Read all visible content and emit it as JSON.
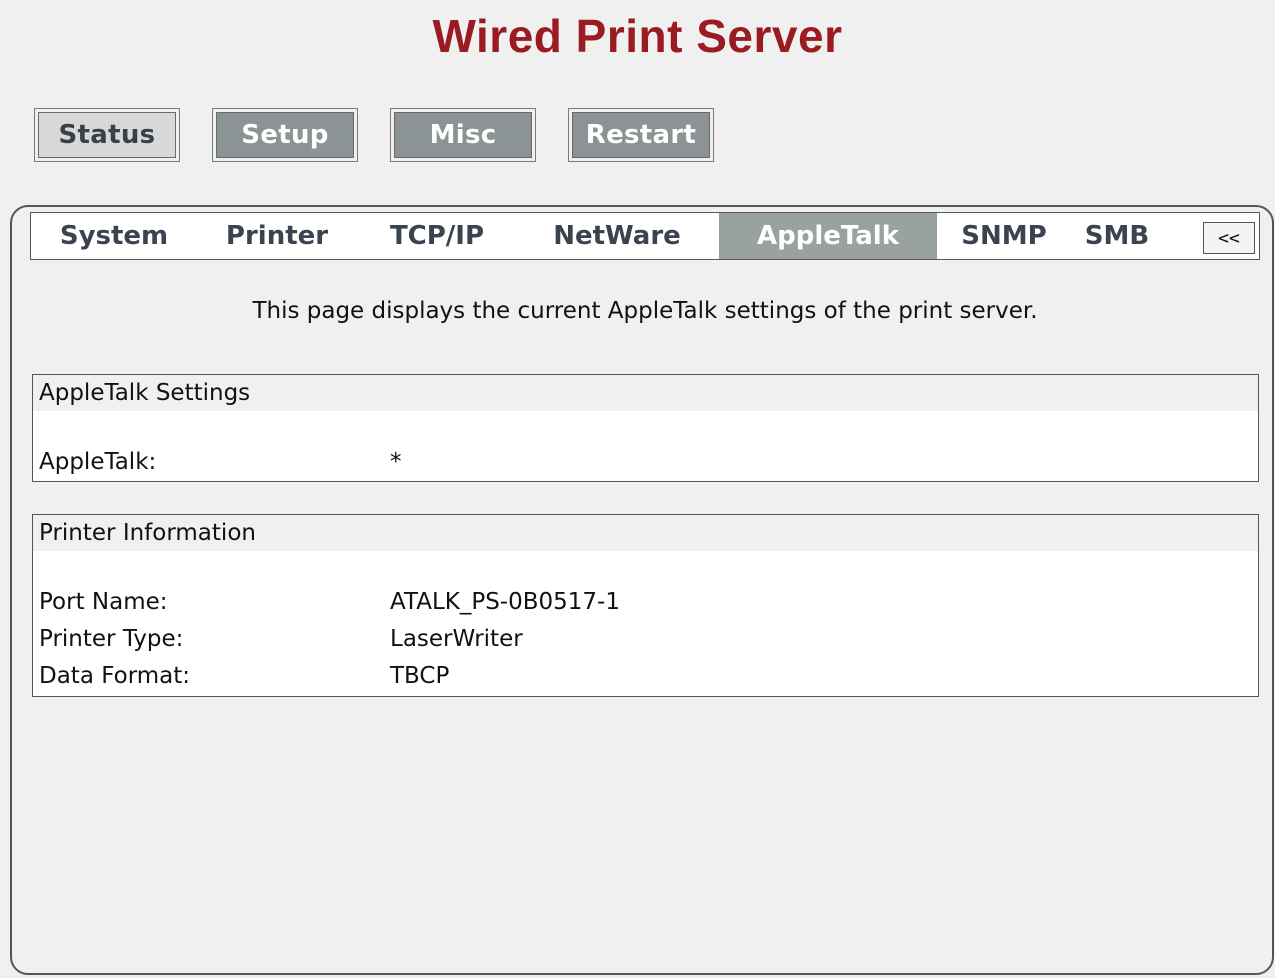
{
  "app": {
    "title": "Wired Print Server"
  },
  "topnav": {
    "items": [
      {
        "label": "Status",
        "active": true
      },
      {
        "label": "Setup",
        "active": false
      },
      {
        "label": "Misc",
        "active": false
      },
      {
        "label": "Restart",
        "active": false
      }
    ]
  },
  "tabs": {
    "items": [
      {
        "label": "System"
      },
      {
        "label": "Printer"
      },
      {
        "label": "TCP/IP"
      },
      {
        "label": "NetWare"
      },
      {
        "label": "AppleTalk",
        "active": true
      },
      {
        "label": "SNMP"
      },
      {
        "label": "SMB"
      }
    ],
    "collapse_label": "<<"
  },
  "intro": "This page displays the current AppleTalk settings of the print server.",
  "appletalk_settings": {
    "header": "AppleTalk Settings",
    "rows": [
      {
        "label": "AppleTalk:",
        "value": "*"
      }
    ]
  },
  "printer_information": {
    "header": "Printer Information",
    "rows": [
      {
        "label": "Port Name:",
        "value": "ATALK_PS-0B0517-1"
      },
      {
        "label": "Printer Type:",
        "value": "LaserWriter"
      },
      {
        "label": "Data Format:",
        "value": "TBCP"
      }
    ]
  },
  "colors": {
    "title": "#9a1c22",
    "background": "#f0f0f0",
    "active_tab": "#9aa1a1",
    "inactive_button": "#8c9394"
  }
}
